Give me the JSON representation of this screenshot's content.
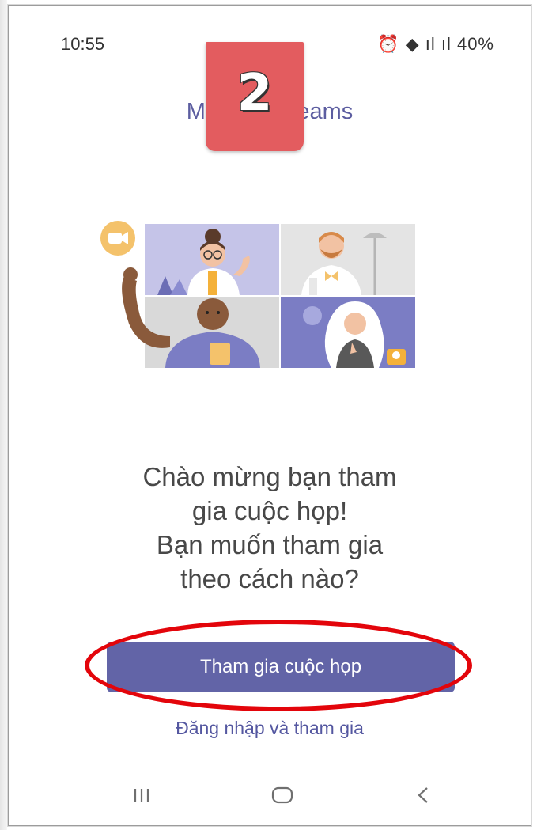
{
  "status_bar": {
    "time": "10:55",
    "icons_text": "40%"
  },
  "app": {
    "title": "Microsoft Teams"
  },
  "badge": {
    "number": "2",
    "color": "#e35c5f"
  },
  "welcome": {
    "lines": [
      "Chào mừng bạn tham",
      "gia cuộc họp!",
      "Bạn muốn tham gia",
      "theo cách nào?"
    ]
  },
  "actions": {
    "join_meeting": "Tham gia cuộc họp",
    "sign_in_and_join": "Đăng nhập và tham gia"
  },
  "navigation": {
    "recent_apps": "recent-apps-icon",
    "home": "home-icon",
    "back": "back-icon"
  },
  "colors": {
    "accent": "#6264a7",
    "highlight_ring": "#e3050b"
  }
}
